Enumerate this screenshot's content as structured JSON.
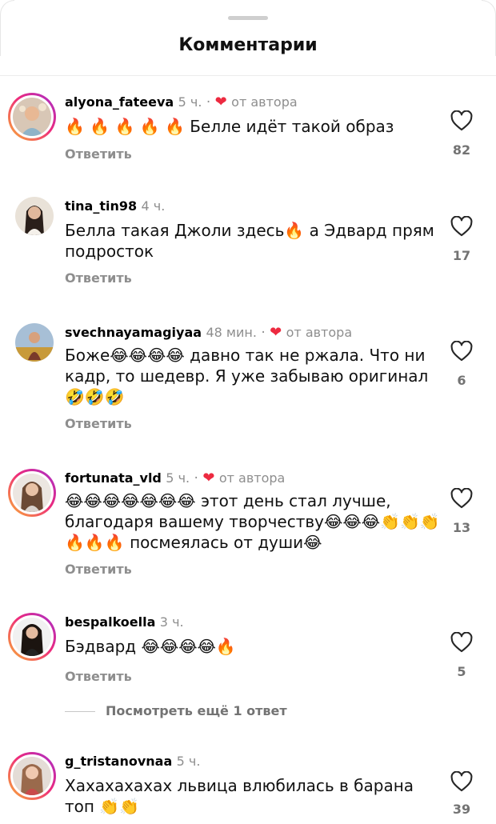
{
  "sheet": {
    "title": "Комментарии"
  },
  "labels": {
    "reply": "Ответить",
    "view_more": "Посмотреть ещё 1 ответ"
  },
  "comments": [
    {
      "user": "alyona_fateeva",
      "time": "5 ч.",
      "sep": "·",
      "author_liked": true,
      "author_label": "от автора",
      "text": "🔥 🔥 🔥 🔥 🔥 Белле идёт такой образ",
      "likes": "82",
      "story_ring": true
    },
    {
      "user": "tina_tin98",
      "time": "4 ч.",
      "author_liked": false,
      "text": "Белла такая Джоли здесь🔥 а Эдвард прям подросток",
      "likes": "17",
      "story_ring": false
    },
    {
      "user": "svechnayamagiyaa",
      "time": "48 мин.",
      "sep": "·",
      "author_liked": true,
      "author_label": "от автора",
      "text": "Боже😂😂😂😂 давно так не ржала. Что ни кадр, то шедевр. Я уже забываю оригинал🤣🤣🤣",
      "likes": "6",
      "story_ring": false
    },
    {
      "user": "fortunata_vld",
      "time": "5 ч.",
      "sep": "·",
      "author_liked": true,
      "author_label": "от автора",
      "text": "😂😂😂😂😂😂😂 этот день стал лучше, благодаря вашему творчеству😂😂😂👏👏👏🔥🔥🔥 посмеялась от души😂",
      "likes": "13",
      "story_ring": true
    },
    {
      "user": "bespalkoella",
      "time": "3 ч.",
      "author_liked": false,
      "text": "Бэдвард 😂😂😂😂🔥",
      "likes": "5",
      "story_ring": true
    },
    {
      "user": "g_tristanovnaa",
      "time": "5 ч.",
      "author_liked": false,
      "text": "Хахахахахах львица влюбилась в барана топ 👏👏",
      "likes": "39",
      "story_ring": true
    }
  ],
  "colors": {
    "author_heart": "#ed2a40",
    "muted": "#8e8e8e",
    "ring_start": "#f9b233",
    "ring_mid": "#ee2a7b",
    "ring_end": "#a32fd0"
  },
  "icons": {
    "like": "heart-outline-icon",
    "author_like": "heart-filled-icon"
  }
}
